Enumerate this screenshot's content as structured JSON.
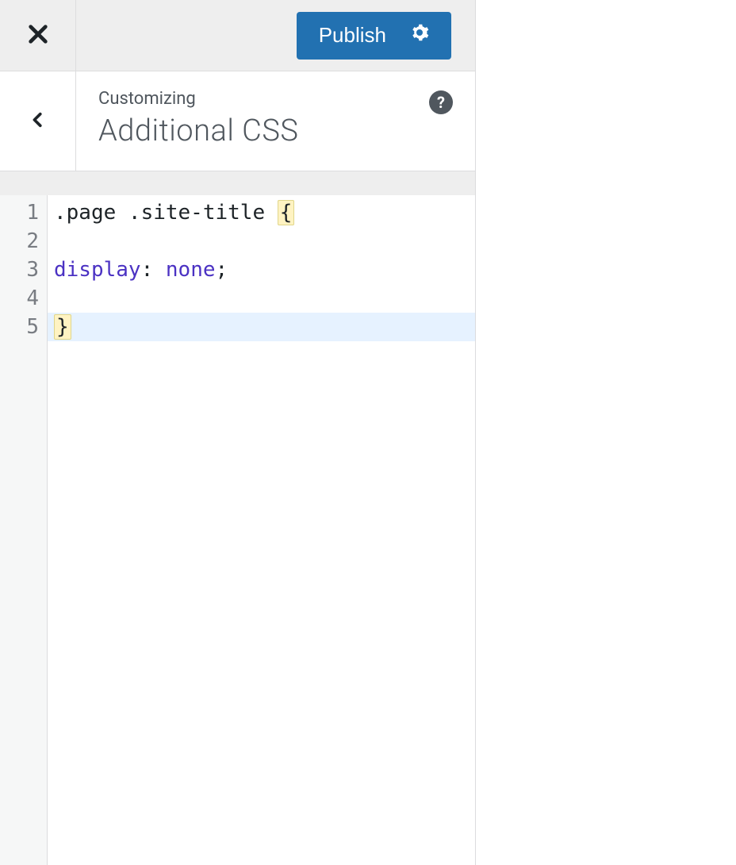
{
  "topbar": {
    "publish_label": "Publish"
  },
  "header": {
    "crumb": "Customizing",
    "title": "Additional CSS",
    "help_char": "?"
  },
  "editor": {
    "line_numbers": [
      "1",
      "2",
      "3",
      "4",
      "5"
    ],
    "active_line_index": 4,
    "lines": [
      {
        "segments": [
          {
            "text": ".page .site-title ",
            "cls": ""
          },
          {
            "text": "{",
            "cls": "tok-brace"
          }
        ]
      },
      {
        "segments": [
          {
            "text": "",
            "cls": ""
          }
        ]
      },
      {
        "segments": [
          {
            "text": "display",
            "cls": "tok-prop"
          },
          {
            "text": ": ",
            "cls": ""
          },
          {
            "text": "none",
            "cls": "tok-prop"
          },
          {
            "text": ";",
            "cls": ""
          }
        ]
      },
      {
        "segments": [
          {
            "text": "",
            "cls": ""
          }
        ]
      },
      {
        "segments": [
          {
            "text": "}",
            "cls": "tok-brace"
          }
        ]
      }
    ]
  }
}
